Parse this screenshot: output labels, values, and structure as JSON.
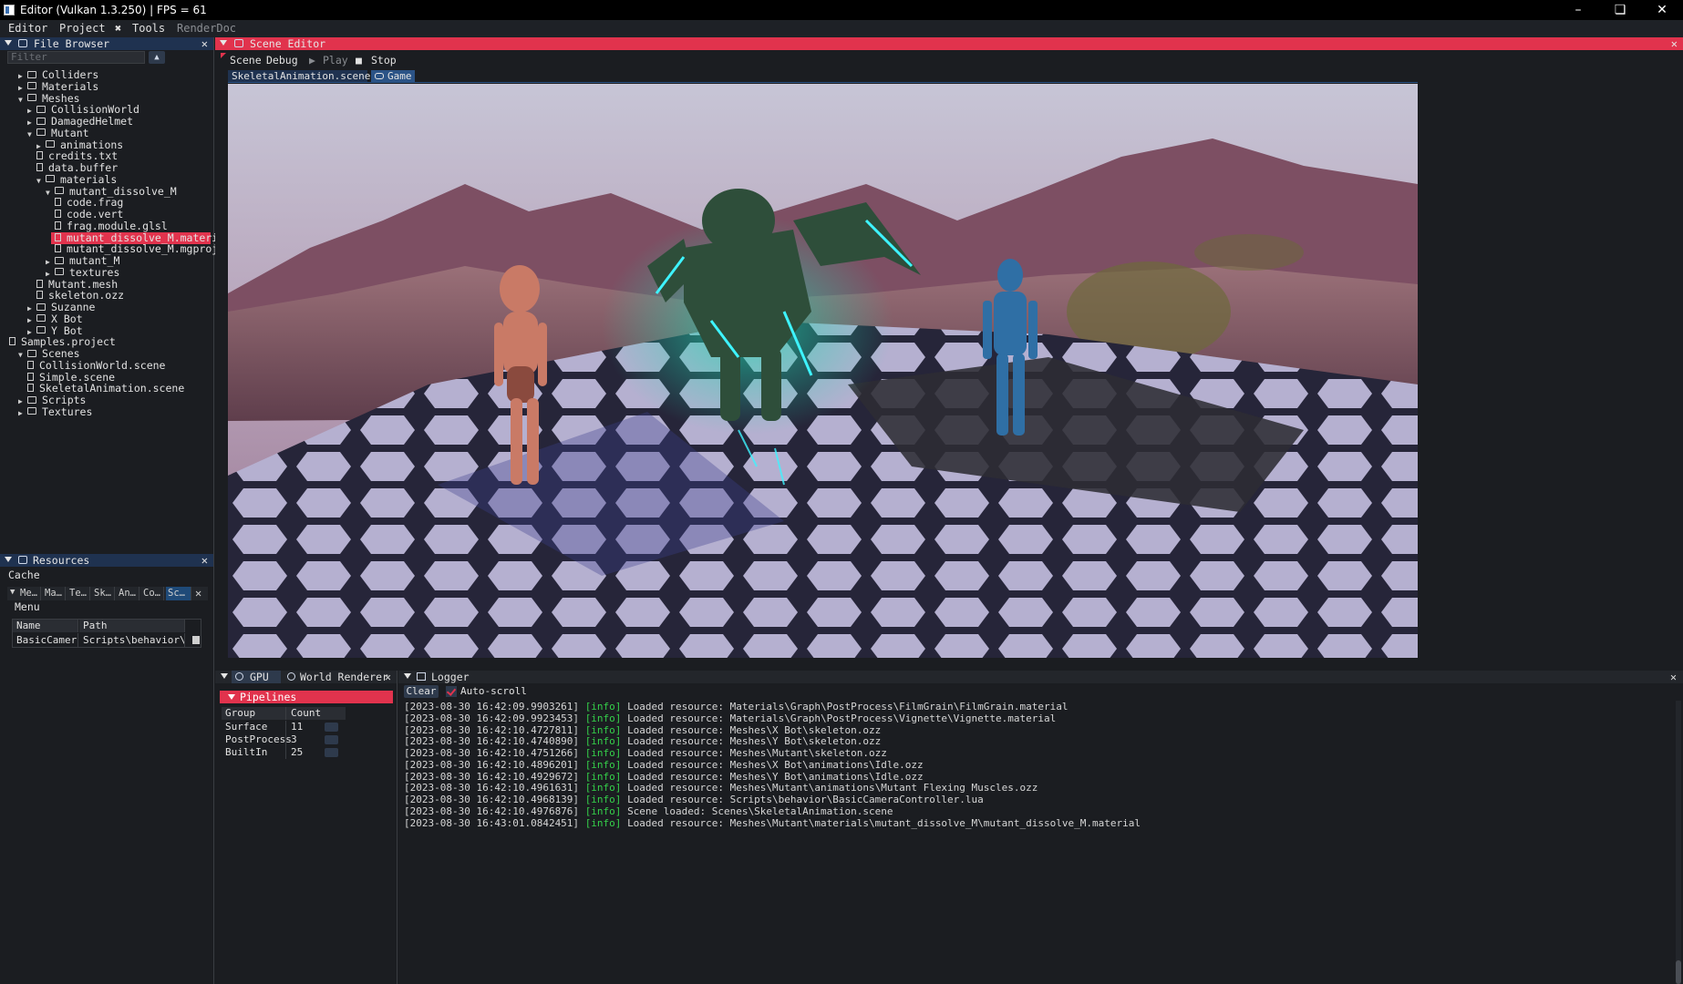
{
  "window": {
    "title": "Editor (Vulkan 1.3.250) | FPS = 61"
  },
  "menu": {
    "items": [
      "Editor",
      "Project",
      "Tools",
      "RenderDoc"
    ]
  },
  "file_browser": {
    "title": "File Browser",
    "filter_placeholder": "Filter",
    "tree": [
      {
        "label": "Colliders",
        "type": "folder",
        "depth": 1,
        "expanded": false
      },
      {
        "label": "Materials",
        "type": "folder",
        "depth": 1,
        "expanded": false
      },
      {
        "label": "Meshes",
        "type": "folder",
        "depth": 1,
        "expanded": true
      },
      {
        "label": "CollisionWorld",
        "type": "folder",
        "depth": 2,
        "expanded": false
      },
      {
        "label": "DamagedHelmet",
        "type": "folder",
        "depth": 2,
        "expanded": false
      },
      {
        "label": "Mutant",
        "type": "folder",
        "depth": 2,
        "expanded": true
      },
      {
        "label": "animations",
        "type": "folder",
        "depth": 3,
        "expanded": false
      },
      {
        "label": "credits.txt",
        "type": "file",
        "depth": 3
      },
      {
        "label": "data.buffer",
        "type": "file",
        "depth": 3
      },
      {
        "label": "materials",
        "type": "folder",
        "depth": 3,
        "expanded": true
      },
      {
        "label": "mutant_dissolve_M",
        "type": "folder",
        "depth": 4,
        "expanded": true
      },
      {
        "label": "code.frag",
        "type": "file",
        "depth": 5
      },
      {
        "label": "code.vert",
        "type": "file",
        "depth": 5
      },
      {
        "label": "frag.module.glsl",
        "type": "file",
        "depth": 5
      },
      {
        "label": "mutant_dissolve_M.material",
        "type": "file",
        "depth": 5,
        "selected": true
      },
      {
        "label": "mutant_dissolve_M.mgproj",
        "type": "file",
        "depth": 5
      },
      {
        "label": "mutant_M",
        "type": "folder",
        "depth": 4,
        "expanded": false
      },
      {
        "label": "textures",
        "type": "folder",
        "depth": 4,
        "expanded": false
      },
      {
        "label": "Mutant.mesh",
        "type": "file",
        "depth": 3
      },
      {
        "label": "skeleton.ozz",
        "type": "file",
        "depth": 3
      },
      {
        "label": "Suzanne",
        "type": "folder",
        "depth": 2,
        "expanded": false
      },
      {
        "label": "X Bot",
        "type": "folder",
        "depth": 2,
        "expanded": false
      },
      {
        "label": "Y Bot",
        "type": "folder",
        "depth": 2,
        "expanded": false
      },
      {
        "label": "Samples.project",
        "type": "file",
        "depth": 0
      },
      {
        "label": "Scenes",
        "type": "folder",
        "depth": 1,
        "expanded": true
      },
      {
        "label": "CollisionWorld.scene",
        "type": "file",
        "depth": 2
      },
      {
        "label": "Simple.scene",
        "type": "file",
        "depth": 2
      },
      {
        "label": "SkeletalAnimation.scene",
        "type": "file",
        "depth": 2
      },
      {
        "label": "Scripts",
        "type": "folder",
        "depth": 1,
        "expanded": false
      },
      {
        "label": "Textures",
        "type": "folder",
        "depth": 1,
        "expanded": false
      }
    ]
  },
  "resources": {
    "title": "Resources",
    "cache_label": "Cache",
    "tabs": [
      "Me…",
      "Ma…",
      "Te…",
      "Sk…",
      "An…",
      "Co…",
      "Sc…"
    ],
    "active_tab": 6,
    "menu_label": "Menu",
    "table": {
      "headers": [
        "Name",
        "Path"
      ],
      "rows": [
        [
          "BasicCamera(",
          "Scripts\\behavior\\Ba"
        ]
      ]
    }
  },
  "scene_editor": {
    "title": "Scene Editor",
    "toolbar": {
      "scene": "Scene",
      "debug": "Debug",
      "play": "Play",
      "stop": "Stop"
    },
    "tabs": [
      "SkeletalAnimation.scene",
      "Game"
    ],
    "active_tab": 1
  },
  "gpu_panel": {
    "tabs": [
      "GPU",
      "World Renderer"
    ],
    "section": "Pipelines",
    "table": {
      "headers": [
        "Group",
        "Count"
      ],
      "rows": [
        [
          "Surface",
          "11"
        ],
        [
          "PostProcess",
          "3"
        ],
        [
          "BuiltIn",
          "25"
        ]
      ]
    }
  },
  "logger": {
    "title": "Logger",
    "clear_label": "Clear",
    "autoscroll_label": "Auto-scroll",
    "autoscroll": true,
    "lines": [
      {
        "time": "[2023-08-30 16:42:09.9903261]",
        "level": "[info]",
        "msg": "Loaded resource: Materials\\Graph\\PostProcess\\FilmGrain\\FilmGrain.material"
      },
      {
        "time": "[2023-08-30 16:42:09.9923453]",
        "level": "[info]",
        "msg": "Loaded resource: Materials\\Graph\\PostProcess\\Vignette\\Vignette.material"
      },
      {
        "time": "[2023-08-30 16:42:10.4727811]",
        "level": "[info]",
        "msg": "Loaded resource: Meshes\\X Bot\\skeleton.ozz"
      },
      {
        "time": "[2023-08-30 16:42:10.4740890]",
        "level": "[info]",
        "msg": "Loaded resource: Meshes\\Y Bot\\skeleton.ozz"
      },
      {
        "time": "[2023-08-30 16:42:10.4751266]",
        "level": "[info]",
        "msg": "Loaded resource: Meshes\\Mutant\\skeleton.ozz"
      },
      {
        "time": "[2023-08-30 16:42:10.4896201]",
        "level": "[info]",
        "msg": "Loaded resource: Meshes\\X Bot\\animations\\Idle.ozz"
      },
      {
        "time": "[2023-08-30 16:42:10.4929672]",
        "level": "[info]",
        "msg": "Loaded resource: Meshes\\Y Bot\\animations\\Idle.ozz"
      },
      {
        "time": "[2023-08-30 16:42:10.4961631]",
        "level": "[info]",
        "msg": "Loaded resource: Meshes\\Mutant\\animations\\Mutant Flexing Muscles.ozz"
      },
      {
        "time": "[2023-08-30 16:42:10.4968139]",
        "level": "[info]",
        "msg": "Loaded resource: Scripts\\behavior\\BasicCameraController.lua"
      },
      {
        "time": "[2023-08-30 16:42:10.4976876]",
        "level": "[info]",
        "msg": "Scene loaded: Scenes\\SkeletalAnimation.scene"
      },
      {
        "time": "[2023-08-30 16:43:01.0842451]",
        "level": "[info]",
        "msg": "Loaded resource: Meshes\\Mutant\\materials\\mutant_dissolve_M\\mutant_dissolve_M.material"
      }
    ]
  },
  "colors": {
    "accent_red": "#e1334d",
    "header_blue": "#1f3250",
    "tab_blue": "#2b5386",
    "info_green": "#35d04a"
  },
  "icons": [
    "folder-icon",
    "file-icon",
    "gear-icon",
    "play-icon",
    "stop-icon",
    "gamepad-icon",
    "clipboard-icon",
    "refresh-icon",
    "trash-icon"
  ]
}
